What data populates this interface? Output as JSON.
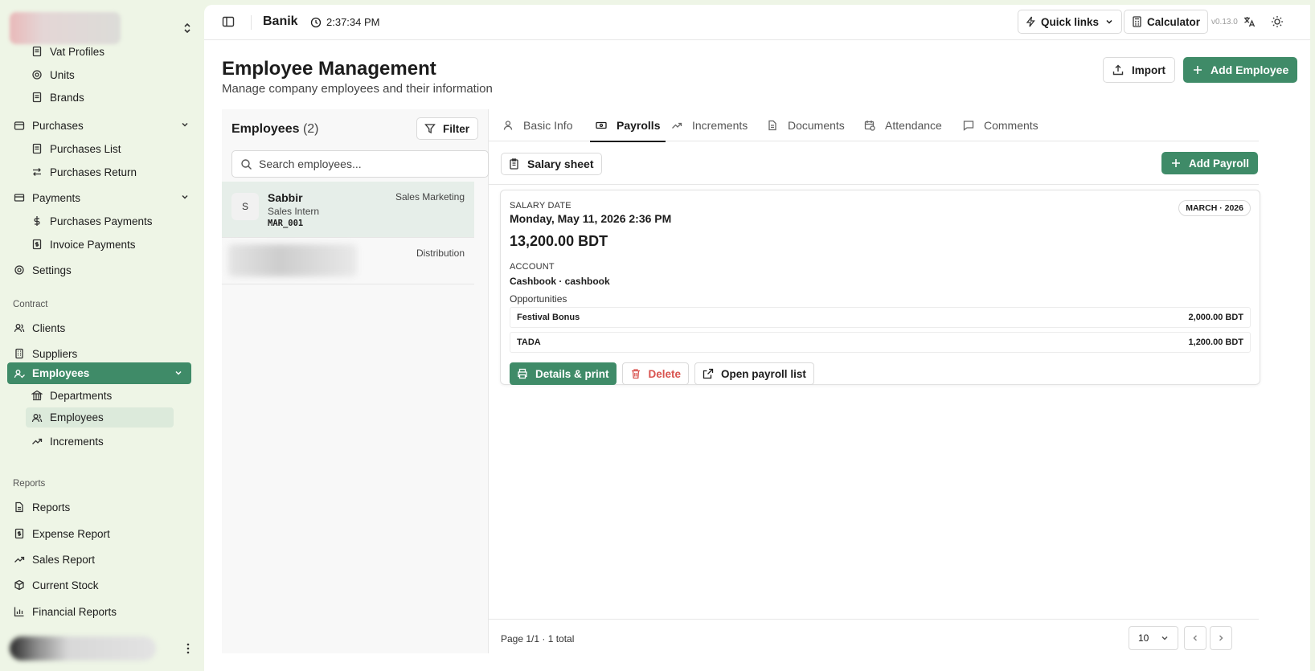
{
  "app": {
    "name": "Banik",
    "time": "2:37:34 PM",
    "quick_links": "Quick links",
    "calculator": "Calculator",
    "version": "v0.13.0"
  },
  "sidebar": {
    "items": [
      {
        "label": "Vat Profiles",
        "icon": "receipt-icon"
      },
      {
        "label": "Units",
        "icon": "gear-icon"
      },
      {
        "label": "Brands",
        "icon": "receipt-icon"
      },
      {
        "label": "Purchases",
        "icon": "wallet-icon"
      },
      {
        "label": "Purchases List",
        "icon": "receipt-icon"
      },
      {
        "label": "Purchases Return",
        "icon": "swap-icon"
      },
      {
        "label": "Payments",
        "icon": "credit-card-icon"
      },
      {
        "label": "Purchases Payments",
        "icon": "dollar-icon"
      },
      {
        "label": "Invoice Payments",
        "icon": "receipt-dollar-icon"
      },
      {
        "label": "Settings",
        "icon": "gear-icon"
      },
      {
        "label": "Clients",
        "icon": "users-icon"
      },
      {
        "label": "Suppliers",
        "icon": "building-icon"
      },
      {
        "label": "Employees",
        "icon": "user-check-icon"
      },
      {
        "label": "Departments",
        "icon": "library-icon"
      },
      {
        "label": "Employees",
        "icon": "users-icon"
      },
      {
        "label": "Increments",
        "icon": "trending-up-icon"
      },
      {
        "label": "Reports",
        "icon": "file-icon"
      },
      {
        "label": "Expense Report",
        "icon": "receipt-dollar-icon"
      },
      {
        "label": "Sales Report",
        "icon": "trending-up-icon"
      },
      {
        "label": "Current Stock",
        "icon": "box-icon"
      },
      {
        "label": "Financial Reports",
        "icon": "bar-chart-icon"
      }
    ],
    "sections": {
      "contract": "Contract",
      "reports": "Reports"
    }
  },
  "page": {
    "title": "Employee Management",
    "subtitle": "Manage company employees and their information",
    "import_label": "Import",
    "add_employee_label": "Add Employee"
  },
  "employees": {
    "title": "Employees",
    "count": "(2)",
    "filter_label": "Filter",
    "search_placeholder": "Search employees...",
    "rows": [
      {
        "initial": "S",
        "name": "Sabbir",
        "role": "Sales Intern",
        "code": "MAR_001",
        "department": "Sales Marketing"
      },
      {
        "department": "Distribution"
      }
    ]
  },
  "tabs": [
    "Basic Info",
    "Payrolls",
    "Increments",
    "Documents",
    "Attendance",
    "Comments"
  ],
  "payroll": {
    "salary_sheet_label": "Salary sheet",
    "add_payroll_label": "Add Payroll",
    "salary_date_label": "SALARY DATE",
    "salary_date": "Monday, May 11, 2026 2:36 PM",
    "period_badge": "MARCH · 2026",
    "amount": "13,200.00 BDT",
    "account_label": "ACCOUNT",
    "account": "Cashbook · cashbook",
    "opportunities_label": "Opportunities",
    "opportunities": [
      {
        "name": "Festival Bonus",
        "amount": "2,000.00 BDT"
      },
      {
        "name": "TADA",
        "amount": "1,200.00 BDT"
      }
    ],
    "details_print_label": "Details & print",
    "delete_label": "Delete",
    "open_list_label": "Open payroll list"
  },
  "pagination": {
    "summary": "Page 1/1 · 1 total",
    "page_size": "10"
  },
  "colors": {
    "accent": "#3f8b68",
    "danger": "#d9534f",
    "sidebar_bg": "#eef5e6"
  }
}
